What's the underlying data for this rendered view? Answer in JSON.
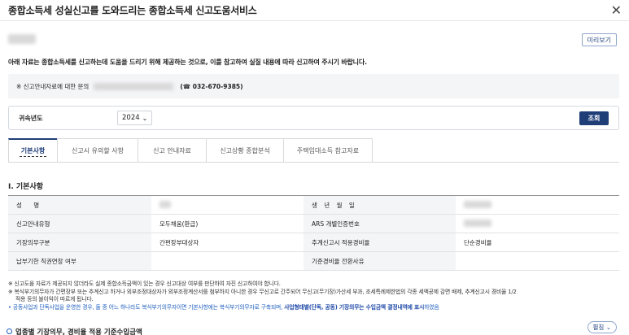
{
  "header": {
    "title": "종합소득세 성실신고를 도와드리는 종합소득세 신고도움서비스",
    "close": "✕"
  },
  "preview_button": "미리보기",
  "intro": "아래 자료는 종합소득세를 신고하는데 도움을 드리기 위해 제공하는 것으로, 이를 참고하여 실질 내용에 따라 신고하여 주시기 바랍니다.",
  "inquiry": {
    "label": "※ 신고안내자료에 대한 문의",
    "phone": "(☎ 032-670-9385)"
  },
  "year_filter": {
    "label": "귀속년도",
    "value": "2024",
    "chevron": "⌄",
    "search_button": "조회"
  },
  "tabs": [
    {
      "label": "기본사항",
      "active": true
    },
    {
      "label": "신고시 유의할 사항",
      "active": false
    },
    {
      "label": "신고 안내자료",
      "active": false
    },
    {
      "label": "신고상황 종합분석",
      "active": false
    },
    {
      "label": "주택임대소득 참고자료",
      "active": false
    }
  ],
  "section_title": "Ⅰ. 기본사항",
  "info_table": {
    "rows": [
      {
        "l1": "성 명",
        "v1": "",
        "l2": "생 년 월 일",
        "v2": ""
      },
      {
        "l1": "신고안내유형",
        "v1": "모두채움(환급)",
        "l2": "ARS 개별인증번호",
        "v2": ""
      },
      {
        "l1": "기장의무구분",
        "v1": "간편장부대상자",
        "l2": "추계신고시 적용경비율",
        "v2": "단순경비율"
      },
      {
        "l1": "납부기한 직권연장 여부",
        "v1": "",
        "l2": "기준경비율 전환사유",
        "v2": ""
      }
    ]
  },
  "notes": {
    "note1": "※ 신고도움 자료가 제공되지 않더라도 실제 종합소득금액이 있는 경우 신고대상 여부를 판단하여 자진 신고하여야 합니다.",
    "note2": "※ 복식부기의무자가 간편장부 또는 추계신고 하거나 외부조정대상자가 외부조정계산서를 첨부하지 아니한 경우 무신고로 간주되어 무신고(무기장)가산세 부과, 조세특례제한법의 각종 세액공제 감면 배제, 추계신고시 경비율 1/2",
    "note2b": "적용 등의 불이익이 따르게 됩니다.",
    "note3_a": "• 공동사업과 단독사업을 운영한 경우, 둘 중 어느 하나라도 복식부기의무자이면 기본사항에는 복식부기의무자로 구축되며,",
    "note3_b": "사업형태별(단독, 공동) 기장의무는 수입금액 결정내역에 표시",
    "note3_c": "하였음"
  },
  "subsection": "업종별 기장의무, 경비율 적용 기준수입금액",
  "expand_button": "펼침 ⌄"
}
